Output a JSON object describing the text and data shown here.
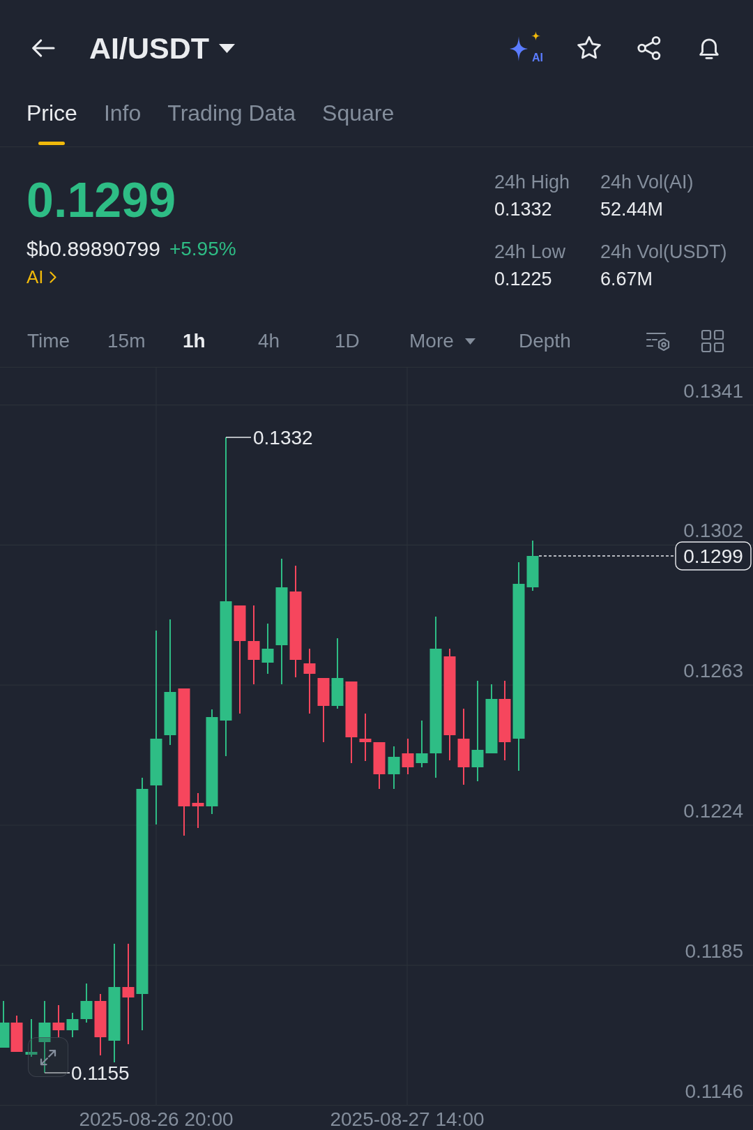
{
  "header": {
    "pair": "AI/USDT",
    "ai_label": "AI"
  },
  "tabs": [
    {
      "label": "Price",
      "selected": true
    },
    {
      "label": "Info",
      "selected": false
    },
    {
      "label": "Trading Data",
      "selected": false
    },
    {
      "label": "Square",
      "selected": false
    }
  ],
  "ticker": {
    "price": "0.1299",
    "up": true,
    "fiat_price": "$b0.89890799",
    "change": "+5.95%",
    "token_link": "AI"
  },
  "stats": [
    {
      "label": "24h High",
      "value": "0.1332"
    },
    {
      "label": "24h Vol(AI)",
      "value": "52.44M"
    },
    {
      "label": "24h Low",
      "value": "0.1225"
    },
    {
      "label": "24h Vol(USDT)",
      "value": "6.67M"
    }
  ],
  "intervals": [
    {
      "label": "Time",
      "kind": "option",
      "selected": false
    },
    {
      "label": "15m",
      "kind": "option",
      "selected": false
    },
    {
      "label": "1h",
      "kind": "option",
      "selected": true
    },
    {
      "label": "4h",
      "kind": "option",
      "selected": false
    },
    {
      "label": "1D",
      "kind": "option",
      "selected": false
    },
    {
      "label": "More",
      "kind": "menu",
      "selected": false
    },
    {
      "label": "Depth",
      "kind": "option",
      "selected": false
    }
  ],
  "chart": {
    "price_axis": [
      "0.1341",
      "0.1302",
      "0.1263",
      "0.1224",
      "0.1185",
      "0.1146"
    ],
    "time_axis": [
      "2025-08-26 20:00",
      "2025-08-27 14:00"
    ],
    "high_marker": "0.1332",
    "low_marker": "0.1155",
    "last_price_tag": "0.1299"
  }
}
